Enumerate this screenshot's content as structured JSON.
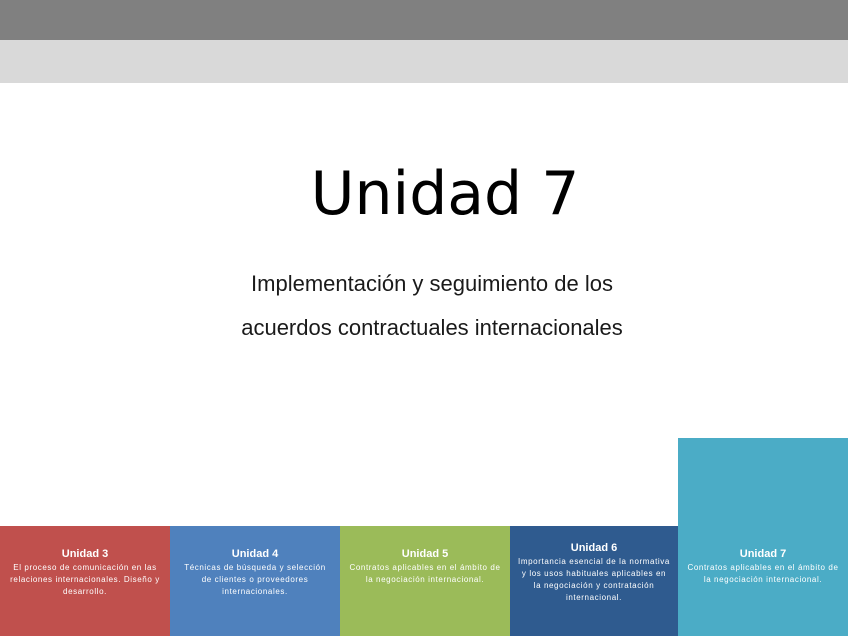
{
  "slide": {
    "title": "Unidad 7",
    "subtitle_line1": "Implementación y seguimiento de los",
    "subtitle_line2": "acuerdos contractuales internacionales"
  },
  "units": [
    {
      "name": "Unidad 3",
      "description": "El proceso de comunicación en las relaciones internacionales. Diseño y desarrollo.",
      "color": "#c0504d"
    },
    {
      "name": "Unidad 4",
      "description": "Técnicas de búsqueda y selección de clientes o proveedores internacionales.",
      "color": "#4f81bd"
    },
    {
      "name": "Unidad 5",
      "description": "Contratos aplicables en el ámbito de la negociación internacional.",
      "color": "#9bbb59"
    },
    {
      "name": "Unidad 6",
      "description": "Importancia esencial de la normativa y los usos habituales aplicables en la negociación y contratación internacional.",
      "color": "#2f5b8f"
    },
    {
      "name": "Unidad 7",
      "description": "Contratos aplicables en el ámbito de la negociación internacional.",
      "color": "#4bacc6"
    }
  ]
}
